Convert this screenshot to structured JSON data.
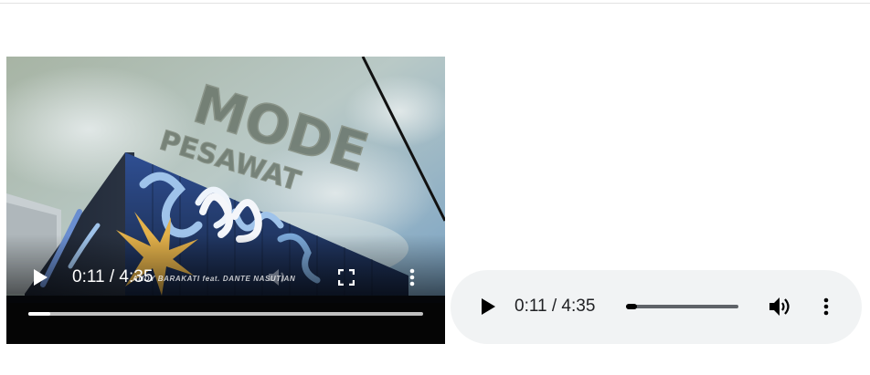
{
  "video_player": {
    "current_time": "0:11",
    "duration": "4:35",
    "time_display": "0:11 / 4:35",
    "progress": 0.04,
    "title_art": "MODE",
    "title_art_sub": "PESAWAT",
    "credit_text": "ANDY BARAKATI feat. DANTE NASUTIAN",
    "icons": {
      "play": "play-icon",
      "volume": "volume-icon",
      "fullscreen": "fullscreen-icon",
      "menu": "more-vert-icon"
    }
  },
  "audio_player": {
    "current_time": "0:11",
    "duration": "4:35",
    "time_display": "0:11 / 4:35",
    "progress": 0.04,
    "icons": {
      "play": "play-icon",
      "volume": "volume-icon",
      "menu": "more-vert-icon"
    }
  },
  "colors": {
    "audio_background": "#f1f3f4",
    "audio_text": "#202124"
  }
}
